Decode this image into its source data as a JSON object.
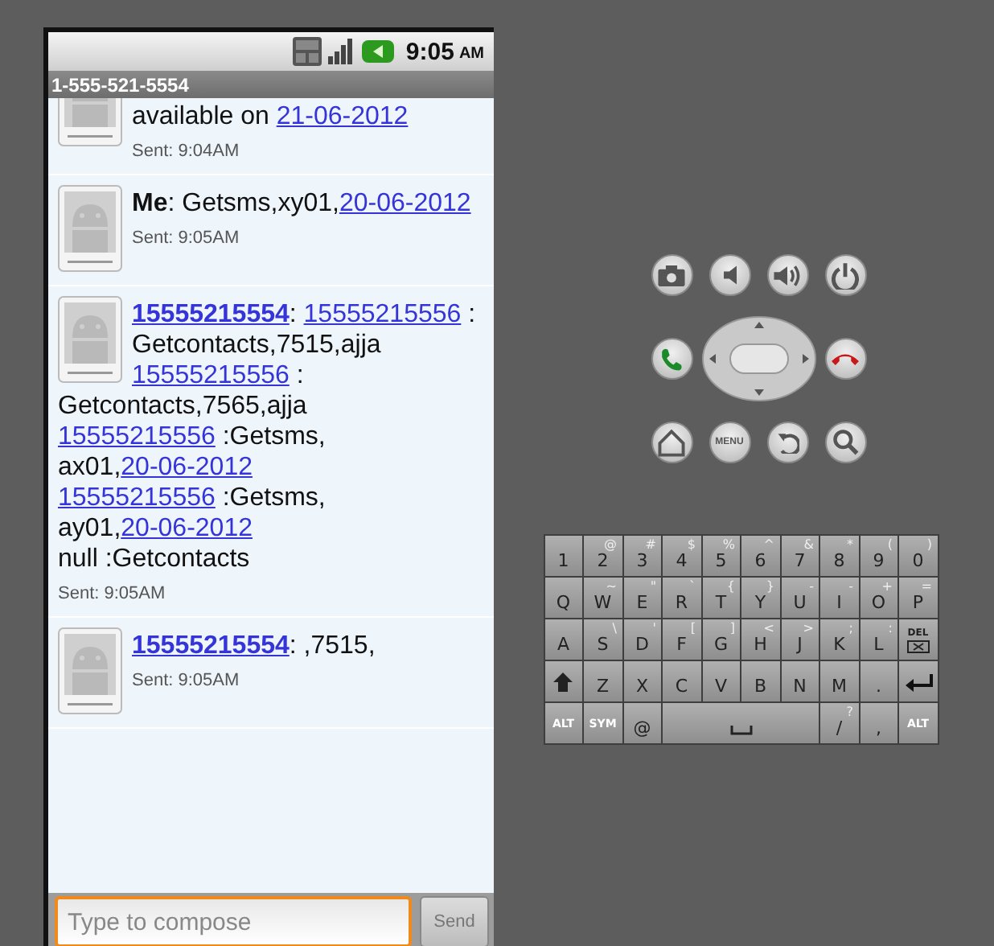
{
  "status_bar": {
    "time": "9:05",
    "meridiem": "AM"
  },
  "title_bar": {
    "title": "1-555-521-5554"
  },
  "messages": [
    {
      "partial": true,
      "lines": [
        [
          {
            "kind": "text",
            "text": "available on "
          },
          {
            "kind": "link",
            "text": "21-06-2012"
          }
        ]
      ],
      "sent": "Sent: 9:04AM"
    },
    {
      "partial": false,
      "lines": [
        [
          {
            "kind": "bold",
            "text": "Me"
          },
          {
            "kind": "text",
            "text": ": Getsms,xy01,"
          },
          {
            "kind": "link",
            "text": "20-06-2012"
          }
        ]
      ],
      "sent": "Sent: 9:05AM"
    },
    {
      "partial": false,
      "lines": [
        [
          {
            "kind": "bold-link",
            "text": "15555215554"
          },
          {
            "kind": "text",
            "text": ": "
          },
          {
            "kind": "link",
            "text": "15555215556"
          },
          {
            "kind": "text",
            "text": " :"
          }
        ],
        [
          {
            "kind": "text",
            "text": "Getcontacts,7515,ajja"
          }
        ],
        [
          {
            "kind": "link",
            "text": "15555215556"
          },
          {
            "kind": "text",
            "text": " :"
          }
        ],
        [
          {
            "kind": "text",
            "text": "Getcontacts,7565,ajja"
          }
        ],
        [
          {
            "kind": "link",
            "text": "15555215556"
          },
          {
            "kind": "text",
            "text": " :Getsms,"
          }
        ],
        [
          {
            "kind": "text",
            "text": "ax01,"
          },
          {
            "kind": "link",
            "text": "20-06-2012"
          }
        ],
        [
          {
            "kind": "link",
            "text": "15555215556"
          },
          {
            "kind": "text",
            "text": " :Getsms,"
          }
        ],
        [
          {
            "kind": "text",
            "text": "ay01,"
          },
          {
            "kind": "link",
            "text": "20-06-2012"
          }
        ],
        [
          {
            "kind": "text",
            "text": "null :Getcontacts"
          }
        ]
      ],
      "sent": "Sent: 9:05AM"
    },
    {
      "partial": false,
      "lines": [
        [
          {
            "kind": "bold-link",
            "text": "15555215554"
          },
          {
            "kind": "text",
            "text": ": ,7515,"
          }
        ]
      ],
      "sent": "Sent: 9:05AM"
    }
  ],
  "compose": {
    "placeholder": "Type to compose",
    "send": "Send"
  },
  "device_buttons": [
    {
      "kind": "camera"
    },
    {
      "kind": "volume-down"
    },
    {
      "kind": "volume-up"
    },
    {
      "kind": "power"
    },
    {
      "kind": "call"
    },
    {
      "kind": "dpad"
    },
    {
      "kind": "end-call"
    },
    {
      "kind": "home"
    },
    {
      "kind": "menu",
      "label": "MENU"
    },
    {
      "kind": "back"
    },
    {
      "kind": "search"
    }
  ],
  "keyboard": [
    [
      {
        "kind": "char",
        "label": "1"
      },
      {
        "kind": "char",
        "label": "2",
        "alt": "@"
      },
      {
        "kind": "char",
        "label": "3",
        "alt": "#"
      },
      {
        "kind": "char",
        "label": "4",
        "alt": "$"
      },
      {
        "kind": "char",
        "label": "5",
        "alt": "%"
      },
      {
        "kind": "char",
        "label": "6",
        "alt": "^"
      },
      {
        "kind": "char",
        "label": "7",
        "alt": "&"
      },
      {
        "kind": "char",
        "label": "8",
        "alt": "*"
      },
      {
        "kind": "char",
        "label": "9",
        "alt": "("
      },
      {
        "kind": "char",
        "label": "0",
        "alt": ")"
      }
    ],
    [
      {
        "kind": "char",
        "label": "Q"
      },
      {
        "kind": "char",
        "label": "W",
        "alt": "~"
      },
      {
        "kind": "char",
        "label": "E",
        "alt": "\""
      },
      {
        "kind": "char",
        "label": "R",
        "alt": "`"
      },
      {
        "kind": "char",
        "label": "T",
        "alt": "{"
      },
      {
        "kind": "char",
        "label": "Y",
        "alt": "}"
      },
      {
        "kind": "char",
        "label": "U",
        "alt": "-"
      },
      {
        "kind": "char",
        "label": "I",
        "alt": "-"
      },
      {
        "kind": "char",
        "label": "O",
        "alt": "+"
      },
      {
        "kind": "char",
        "label": "P",
        "alt": "="
      }
    ],
    [
      {
        "kind": "char",
        "label": "A"
      },
      {
        "kind": "char",
        "label": "S",
        "alt": "\\"
      },
      {
        "kind": "char",
        "label": "D",
        "alt": "'"
      },
      {
        "kind": "char",
        "label": "F",
        "alt": "["
      },
      {
        "kind": "char",
        "label": "G",
        "alt": "]"
      },
      {
        "kind": "char",
        "label": "H",
        "alt": "<"
      },
      {
        "kind": "char",
        "label": "J",
        "alt": ">"
      },
      {
        "kind": "char",
        "label": "K",
        "alt": ";"
      },
      {
        "kind": "char",
        "label": "L",
        "alt": ":"
      },
      {
        "kind": "del",
        "label": "DEL"
      }
    ],
    [
      {
        "kind": "shift"
      },
      {
        "kind": "char",
        "label": "Z"
      },
      {
        "kind": "char",
        "label": "X"
      },
      {
        "kind": "char",
        "label": "C"
      },
      {
        "kind": "char",
        "label": "V"
      },
      {
        "kind": "char",
        "label": "B"
      },
      {
        "kind": "char",
        "label": "N"
      },
      {
        "kind": "char",
        "label": "M"
      },
      {
        "kind": "char",
        "label": "."
      },
      {
        "kind": "enter"
      }
    ],
    [
      {
        "kind": "small",
        "label": "ALT"
      },
      {
        "kind": "small",
        "label": "SYM"
      },
      {
        "kind": "char",
        "label": "@"
      },
      {
        "kind": "space"
      },
      {
        "kind": "char",
        "label": "/",
        "alt": "?"
      },
      {
        "kind": "char",
        "label": ","
      },
      {
        "kind": "small",
        "label": "ALT"
      }
    ]
  ]
}
